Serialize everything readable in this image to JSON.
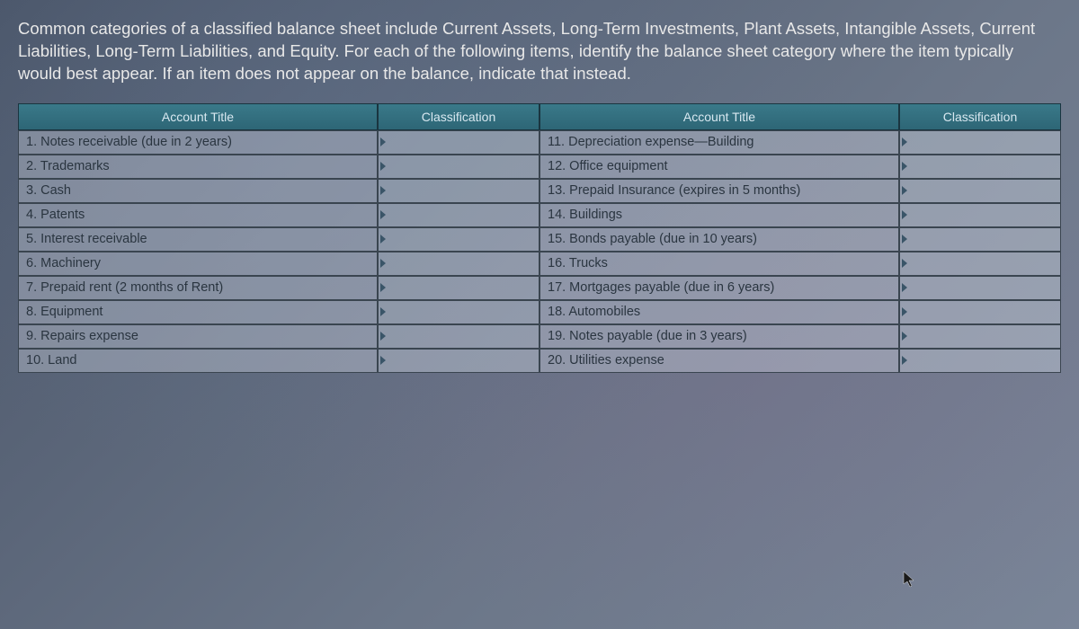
{
  "instructions": "Common categories of a classified balance sheet include Current Assets, Long-Term Investments, Plant Assets, Intangible Assets, Current Liabilities, Long-Term Liabilities, and Equity. For each of the following items, identify the balance sheet category where the item typically would best appear. If an item does not appear on the balance, indicate that instead.",
  "headers": {
    "account_title": "Account Title",
    "classification": "Classification"
  },
  "left_items": [
    {
      "num": "1",
      "title": "Notes receivable (due in 2 years)"
    },
    {
      "num": "2",
      "title": "Trademarks"
    },
    {
      "num": "3",
      "title": "Cash"
    },
    {
      "num": "4",
      "title": "Patents"
    },
    {
      "num": "5",
      "title": "Interest receivable"
    },
    {
      "num": "6",
      "title": "Machinery"
    },
    {
      "num": "7",
      "title": "Prepaid rent (2 months of Rent)"
    },
    {
      "num": "8",
      "title": "Equipment"
    },
    {
      "num": "9",
      "title": "Repairs expense"
    },
    {
      "num": "10",
      "title": "Land"
    }
  ],
  "right_items": [
    {
      "num": "11",
      "title": "Depreciation expense—Building"
    },
    {
      "num": "12",
      "title": "Office equipment"
    },
    {
      "num": "13",
      "title": "Prepaid Insurance (expires in 5 months)"
    },
    {
      "num": "14",
      "title": "Buildings"
    },
    {
      "num": "15",
      "title": "Bonds payable (due in 10 years)"
    },
    {
      "num": "16",
      "title": "Trucks"
    },
    {
      "num": "17",
      "title": "Mortgages payable (due in 6 years)"
    },
    {
      "num": "18",
      "title": "Automobiles"
    },
    {
      "num": "19",
      "title": "Notes payable (due in 3 years)"
    },
    {
      "num": "20",
      "title": "Utilities expense"
    }
  ]
}
